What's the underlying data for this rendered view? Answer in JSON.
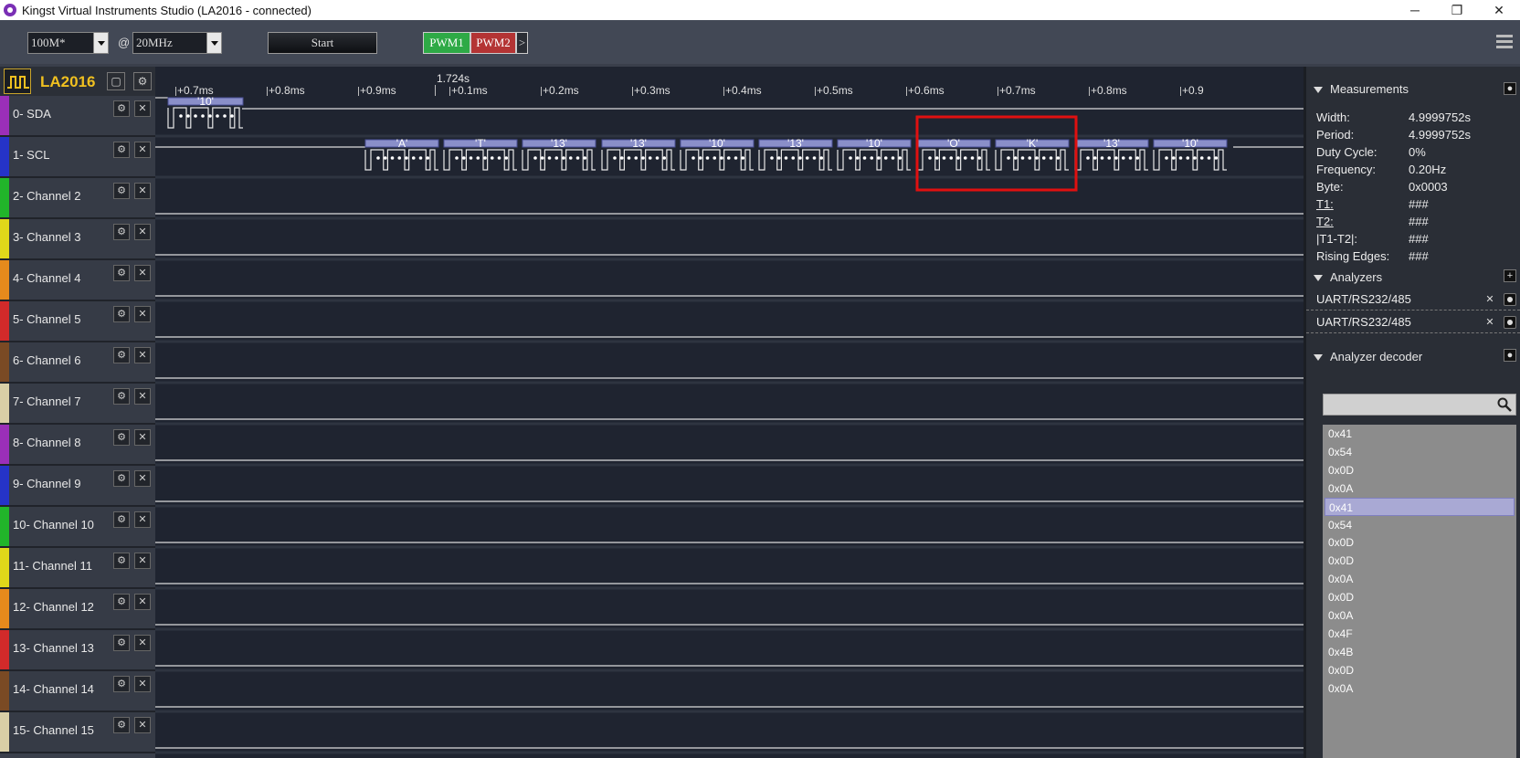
{
  "window": {
    "title": "Kingst Virtual Instruments Studio (LA2016 - connected)",
    "minimize": "─",
    "restore": "❐",
    "close": "✕"
  },
  "toolbar": {
    "depth_value": "100M*",
    "at_label": "@",
    "rate_value": "20MHz",
    "start_label": "Start",
    "pwm1_label": "PWM1",
    "pwm2_label": "PWM2",
    "pwm_more_label": ">"
  },
  "device": {
    "name": "LA2016",
    "layout_icon": "window-icon",
    "settings_icon": "gear-icon"
  },
  "ruler": {
    "center_time": "1.724s",
    "ticks": [
      "+0.7ms",
      "+0.8ms",
      "+0.9ms",
      "+0.1ms",
      "+0.2ms",
      "+0.3ms",
      "+0.4ms",
      "+0.5ms",
      "+0.6ms",
      "+0.7ms",
      "+0.8ms",
      "+0.9"
    ]
  },
  "channels": [
    {
      "label": "0-  SDA",
      "color": "#9b2fb8"
    },
    {
      "label": "1-  SCL",
      "color": "#2533c8"
    },
    {
      "label": "2-  Channel 2",
      "color": "#21b52a"
    },
    {
      "label": "3-  Channel 3",
      "color": "#e0d81a"
    },
    {
      "label": "4-  Channel 4",
      "color": "#e68a1c"
    },
    {
      "label": "5-  Channel 5",
      "color": "#d22a2a"
    },
    {
      "label": "6-  Channel 6",
      "color": "#7a4a24"
    },
    {
      "label": "7-  Channel 7",
      "color": "#d9cfa6"
    },
    {
      "label": "8-  Channel 8",
      "color": "#9b2fb8"
    },
    {
      "label": "9-  Channel 9",
      "color": "#2533c8"
    },
    {
      "label": "10-  Channel 10",
      "color": "#21b52a"
    },
    {
      "label": "11-  Channel 11",
      "color": "#e0d81a"
    },
    {
      "label": "12-  Channel 12",
      "color": "#e68a1c"
    },
    {
      "label": "13-  Channel 13",
      "color": "#d22a2a"
    },
    {
      "label": "14-  Channel 14",
      "color": "#7a4a24"
    },
    {
      "label": "15-  Channel 15",
      "color": "#d9cfa6"
    }
  ],
  "decodes": {
    "sda": [
      "'10'"
    ],
    "scl": [
      "'A'",
      "'T'",
      "'13'",
      "'13'",
      "'10'",
      "'13'",
      "'10'",
      "'O'",
      "'K'",
      "'13'",
      "'10'"
    ]
  },
  "measurements": {
    "title": "Measurements",
    "rows": [
      {
        "label": "Width:",
        "value": "4.9999752s"
      },
      {
        "label": "Period:",
        "value": "4.9999752s"
      },
      {
        "label": "Duty Cycle:",
        "value": "0%"
      },
      {
        "label": "Frequency:",
        "value": "0.20Hz"
      },
      {
        "label": "Byte:",
        "value": "0x0003"
      },
      {
        "label": "T1:",
        "value": "###"
      },
      {
        "label": "T2:",
        "value": "###"
      },
      {
        "label": "|T1-T2|:",
        "value": "###"
      },
      {
        "label": "Rising Edges:",
        "value": "###"
      }
    ]
  },
  "analyzers": {
    "title": "Analyzers",
    "add_label": "+",
    "items": [
      "UART/RS232/485",
      "UART/RS232/485"
    ],
    "remove_label": "✕"
  },
  "decoder": {
    "title": "Analyzer decoder",
    "search_value": "",
    "items": [
      "0x41",
      "0x54",
      "0x0D",
      "0x0A",
      "0x41",
      "0x54",
      "0x0D",
      "0x0D",
      "0x0A",
      "0x0D",
      "0x0A",
      "0x4F",
      "0x4B",
      "0x0D",
      "0x0A"
    ],
    "selected_index": 4
  },
  "colors": {
    "highlight_box": "#e01010",
    "pwm1": "#2eaa46",
    "pwm2": "#b43434",
    "device_name": "#f0c020"
  }
}
